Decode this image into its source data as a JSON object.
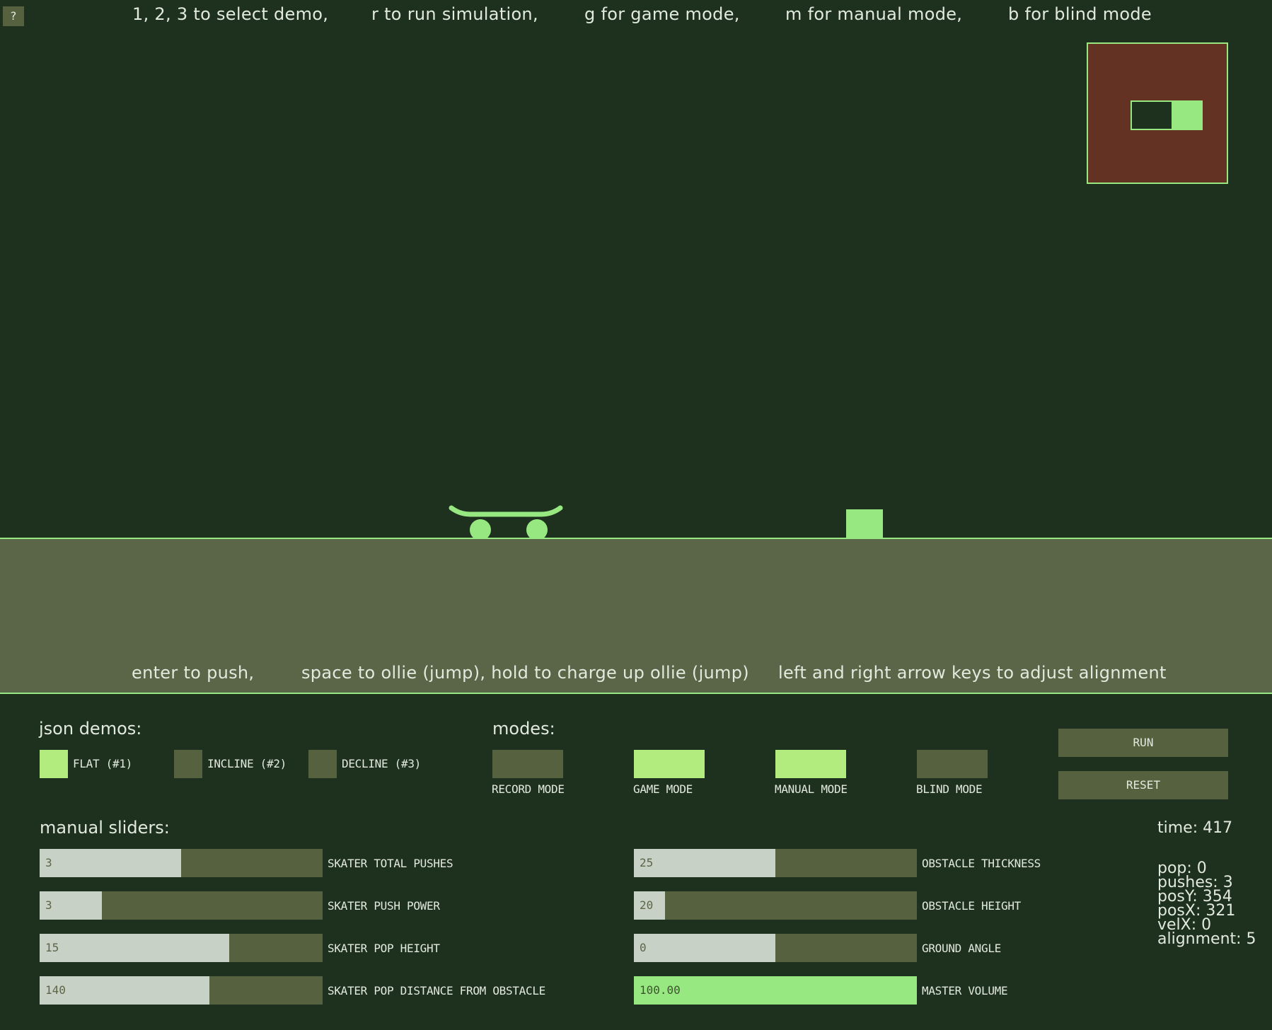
{
  "help_button": "?",
  "top_hints": [
    "1, 2, 3 to select demo,",
    "r to run simulation,",
    "g for game mode,",
    "m for manual mode,",
    "b for blind mode"
  ],
  "bottom_hints": [
    "enter to push,",
    "space to ollie (jump), hold to charge up ollie (jump)",
    "left and right arrow keys to adjust alignment"
  ],
  "demos": {
    "heading": "json demos:",
    "items": [
      {
        "label": "FLAT (#1)",
        "selected": true
      },
      {
        "label": "INCLINE (#2)",
        "selected": false
      },
      {
        "label": "DECLINE (#3)",
        "selected": false
      }
    ]
  },
  "modes": {
    "heading": "modes:",
    "items": [
      {
        "label": "RECORD MODE",
        "on": false
      },
      {
        "label": "GAME MODE",
        "on": true
      },
      {
        "label": "MANUAL MODE",
        "on": true
      },
      {
        "label": "BLIND MODE",
        "on": false
      }
    ]
  },
  "buttons": {
    "run": "RUN",
    "reset": "RESET"
  },
  "sliders": {
    "heading": "manual sliders:",
    "left": [
      {
        "label": "SKATER TOTAL PUSHES",
        "value": "3",
        "fraction": 0.5
      },
      {
        "label": "SKATER PUSH POWER",
        "value": "3",
        "fraction": 0.22
      },
      {
        "label": "SKATER POP HEIGHT",
        "value": "15",
        "fraction": 0.67
      },
      {
        "label": "SKATER POP DISTANCE FROM OBSTACLE",
        "value": "140",
        "fraction": 0.6
      }
    ],
    "right": [
      {
        "label": "OBSTACLE THICKNESS",
        "value": "25",
        "fraction": 0.5
      },
      {
        "label": "OBSTACLE HEIGHT",
        "value": "20",
        "fraction": 0.11
      },
      {
        "label": "GROUND ANGLE",
        "value": "0",
        "fraction": 0.5
      },
      {
        "label": "MASTER VOLUME",
        "value": "100.00",
        "fraction": 1.0
      }
    ]
  },
  "time_text": "time: 417",
  "stats": [
    "pop: 0",
    "pushes: 3",
    "posY: 354",
    "posX: 321",
    "velX: 0",
    "alignment: 5"
  ],
  "colors": {
    "background": "#1e311f",
    "accent": "#97e880",
    "toggle_on": "#b3ec7e",
    "panel": "#56623f",
    "ground": "#5a6647",
    "minimap": "#643222"
  }
}
